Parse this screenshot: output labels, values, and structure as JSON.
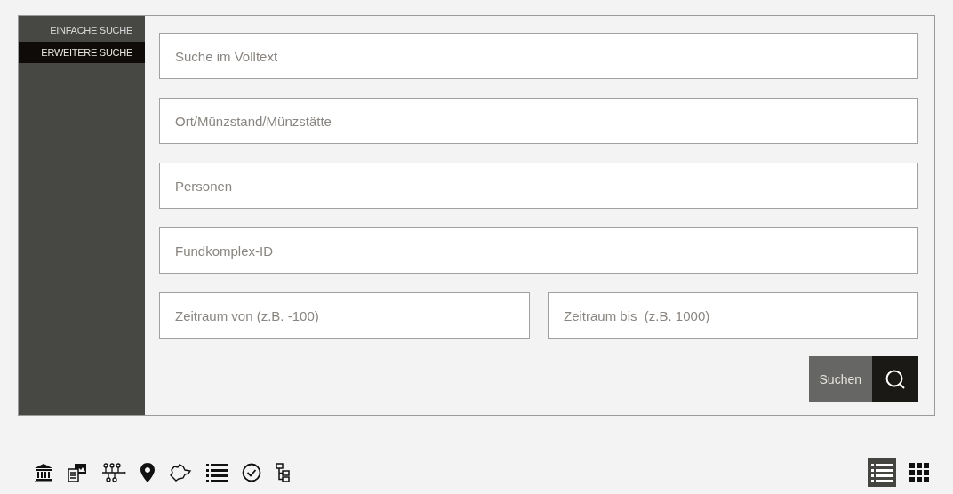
{
  "tabs": [
    {
      "label": "EINFACHE SUCHE",
      "selected": false
    },
    {
      "label": "ERWEITERE SUCHE",
      "selected": true
    }
  ],
  "fields": [
    {
      "placeholder": "Suche im Volltext"
    },
    {
      "placeholder": "Ort/Münzstand/Münzstätte"
    },
    {
      "placeholder": "Personen"
    },
    {
      "placeholder": "Fundkomplex-ID"
    }
  ],
  "range_fields": [
    {
      "placeholder": "Zeitraum von (z.B. -100)"
    },
    {
      "placeholder": "Zeitraum bis  (z.B. 1000)"
    }
  ],
  "search_button": {
    "label": "Suchen"
  },
  "toolbar": [
    {
      "kind": "museum"
    },
    {
      "kind": "gallery"
    },
    {
      "kind": "network"
    },
    {
      "kind": "pin"
    },
    {
      "kind": "region"
    },
    {
      "kind": "list"
    },
    {
      "kind": "check"
    },
    {
      "kind": "tree"
    }
  ],
  "view_toggles": [
    {
      "kind": "list",
      "selected": true
    },
    {
      "kind": "grid",
      "selected": false
    }
  ]
}
